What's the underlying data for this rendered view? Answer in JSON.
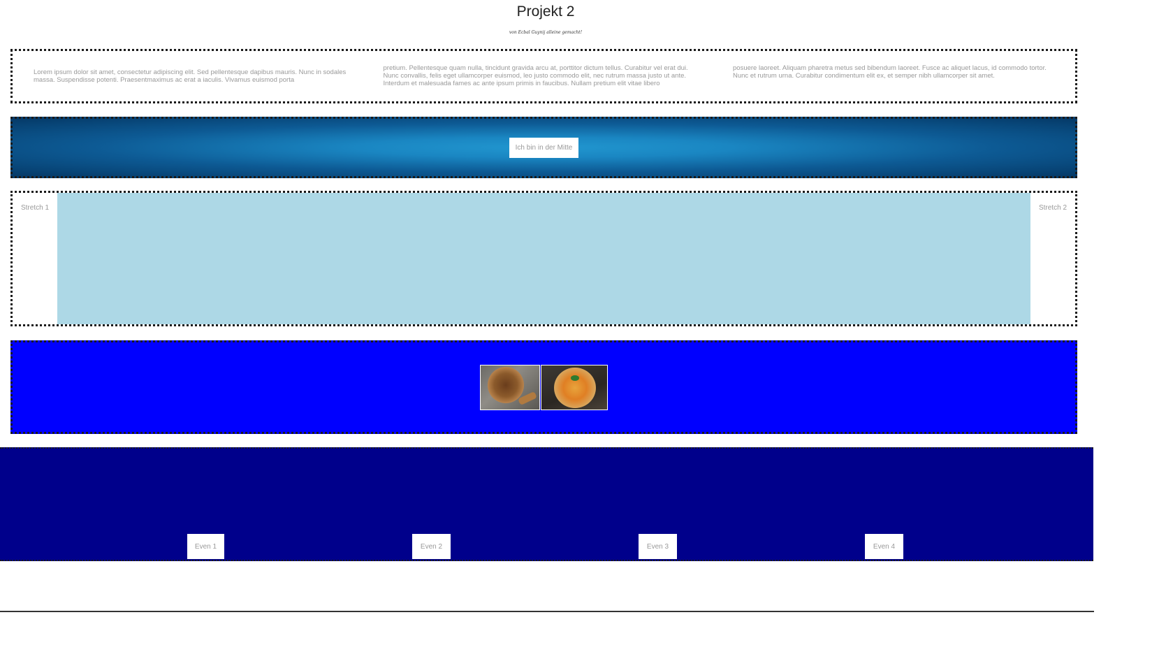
{
  "header": {
    "title": "Projekt 2",
    "subtitle": "von Ecbal Guynij alleine gemacht!"
  },
  "text_section": {
    "columns": [
      "Lorem ipsum dolor sit amet, consectetur adipiscing elit. Sed pellentesque dapibus mauris. Nunc in sodales massa. Suspendisse potenti. Praesentmaximus ac erat a iaculis. Vivamus euismod porta",
      "pretium. Pellentesque quam nulla, tincidunt gravida arcu at, porttitor dictum tellus. Curabitur vel erat dui. Nunc convallis, felis eget ullamcorper euismod, leo justo commodo elit, nec rutrum massa justo ut ante. Interdum et malesuada fames ac ante ipsum primis in faucibus. Nullam pretium elit vitae libero",
      "posuere laoreet. Aliquam pharetra metus sed bibendum laoreet. Fusce ac aliquet lacus, id commodo tortor. Nunc et rutrum urna. Curabitur condimentum elit ex, et semper nibh ullamcorper sit amet."
    ]
  },
  "center_section": {
    "button_label": "Ich bin in der Mitte"
  },
  "stretch_section": {
    "left_label": "Stretch 1",
    "right_label": "Stretch 2"
  },
  "image_section": {
    "images": [
      "pizza-image",
      "pizza-image"
    ]
  },
  "even_section": {
    "items": [
      "Even 1",
      "Even 2",
      "Even 3",
      "Even 4"
    ]
  },
  "colors": {
    "stretch_fill": "#add8e6",
    "image_section_bg": "#0000ff",
    "even_section_bg": "#00008b",
    "gradient_center": "#2196cf",
    "gradient_edge": "#053a68"
  }
}
